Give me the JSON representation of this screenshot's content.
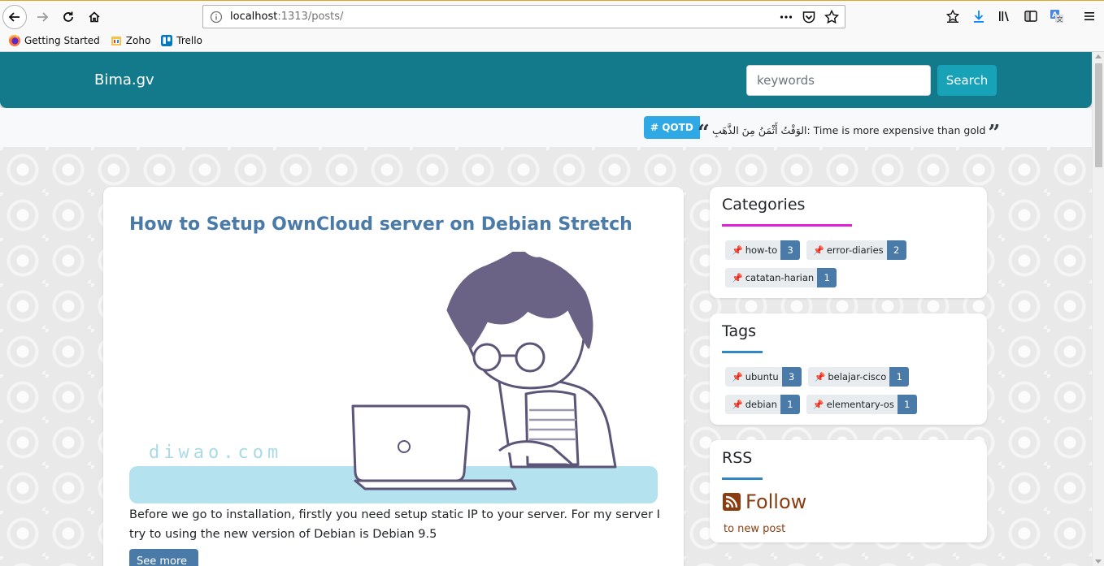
{
  "browser": {
    "url_host": "localhost",
    "url_rest": ":1313/posts/",
    "bookmarks": [
      {
        "label": "Getting Started"
      },
      {
        "label": "Zoho"
      },
      {
        "label": "Trello"
      }
    ]
  },
  "navbar": {
    "brand": "Bima.gv",
    "search_placeholder": "keywords",
    "search_label": "Search"
  },
  "qotd": {
    "badge": "# QOTD",
    "text": "الوَقْتُ أَثْمَنُ مِنَ الذَّهَبِ: Time is more expensive than gold"
  },
  "post": {
    "title": "How to Setup OwnCloud server on Debian Stretch",
    "image_watermark": "diwao.com",
    "excerpt": "Before we go to installation, firstly you need setup static IP to your server. For my server I try to using the new version of Debian is Debian 9.5",
    "see_more": "See more"
  },
  "sidebar": {
    "categories": {
      "title": "Categories",
      "accent": "#e020d8",
      "items": [
        {
          "label": "how-to",
          "count": "3"
        },
        {
          "label": "error-diaries",
          "count": "2"
        },
        {
          "label": "catatan-harian",
          "count": "1"
        }
      ]
    },
    "tags": {
      "title": "Tags",
      "accent": "#2f87c8",
      "items": [
        {
          "label": "ubuntu",
          "count": "3"
        },
        {
          "label": "belajar-cisco",
          "count": "1"
        },
        {
          "label": "debian",
          "count": "1"
        },
        {
          "label": "elementary-os",
          "count": "1"
        }
      ]
    },
    "rss": {
      "title": "RSS",
      "follow": "Follow",
      "sub": "to new post"
    }
  },
  "colors": {
    "navbar": "#137a8c",
    "accent_button": "#17a2b8",
    "post_title": "#4a7aa8",
    "rss": "#8b3d0f"
  }
}
